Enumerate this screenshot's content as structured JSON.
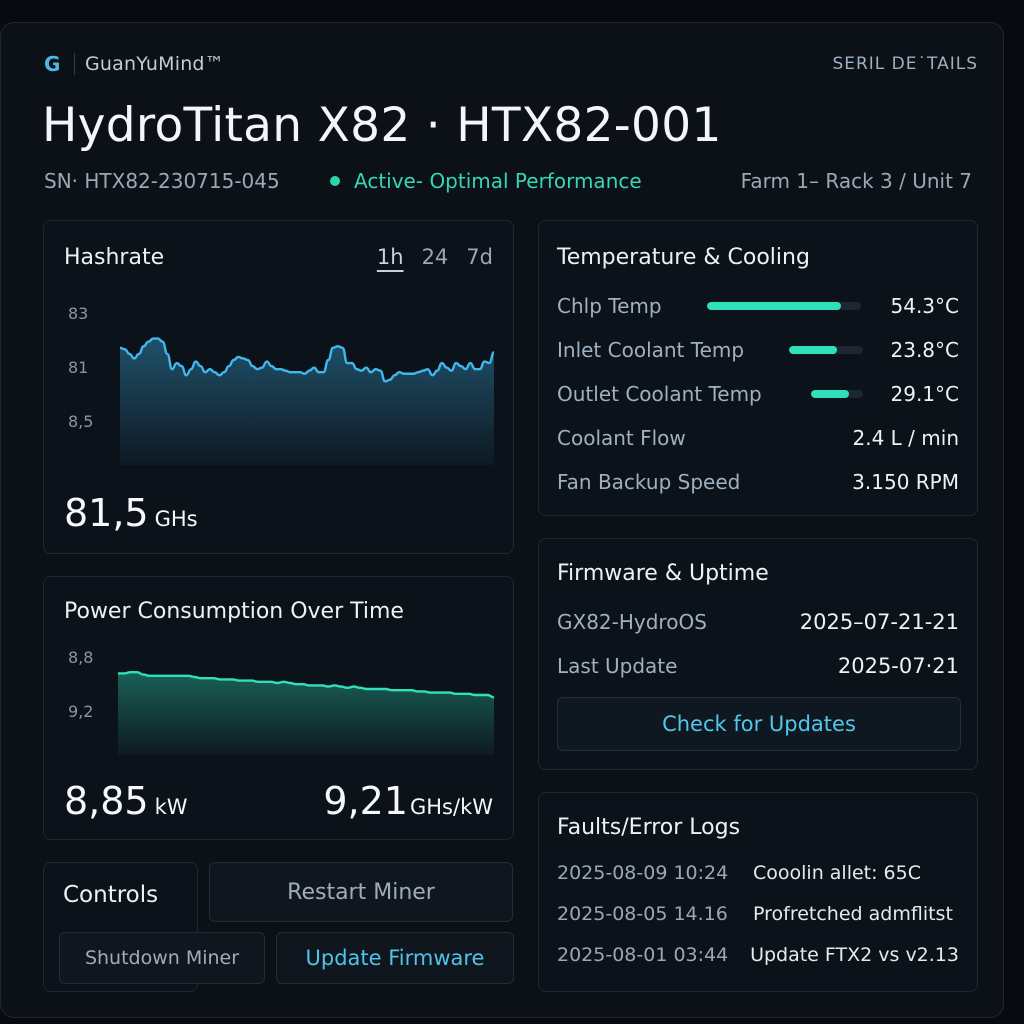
{
  "header": {
    "brand": "GuanYuMind™",
    "brand_icon": "G",
    "serial_link": "SERIL DE˙TAILS",
    "title": "HydroTitan X82 · HTX82-001",
    "serial": "SN· HTX82-230715-045",
    "status": "Active- Optimal Performance",
    "location": "Farm 1– Rack 3 / Unit 7"
  },
  "colors": {
    "accent": "#2ed3ad",
    "hash_line": "#3fb8f0",
    "power_line": "#2fe0bb",
    "link": "#4fc3e8"
  },
  "hashrate": {
    "title": "Hashrate",
    "ranges": [
      "1h",
      "24",
      "7d"
    ],
    "active_range": "1h",
    "value": "81,5",
    "unit": "GHs"
  },
  "power": {
    "title": "Power Consumption Over Time",
    "value": "8,85",
    "unit": "kW",
    "efficiency_value": "9,21",
    "efficiency_unit": "GHs/kW"
  },
  "chart_data": [
    {
      "type": "area",
      "name": "hashrate",
      "y_tick_labels": [
        "83",
        "81",
        "8,5"
      ],
      "ylim": [
        80,
        83.6
      ],
      "grid": false,
      "x": [
        0,
        1,
        2,
        3,
        4,
        5,
        6,
        7,
        8,
        9,
        10,
        11,
        12,
        13,
        14,
        15,
        16,
        17,
        18,
        19,
        20,
        21,
        22,
        23,
        24,
        25,
        26,
        27,
        28,
        29,
        30,
        31,
        32,
        33,
        34,
        35,
        36,
        37,
        38,
        39,
        40,
        41,
        42,
        43,
        44,
        45,
        46,
        47,
        48,
        49,
        50,
        51,
        52,
        53,
        54,
        55,
        56,
        57,
        58,
        59,
        60,
        61,
        62,
        63,
        64,
        65,
        66,
        67,
        68,
        69,
        70,
        71,
        72,
        73,
        74,
        75,
        76,
        77,
        78,
        79
      ],
      "y": [
        82.2,
        82.15,
        82.0,
        81.85,
        82.0,
        82.25,
        82.4,
        82.5,
        82.5,
        82.4,
        82.0,
        81.5,
        81.7,
        81.6,
        81.3,
        81.5,
        81.75,
        81.6,
        81.4,
        81.5,
        81.4,
        81.3,
        81.4,
        81.6,
        81.8,
        81.9,
        81.85,
        81.8,
        81.6,
        81.5,
        81.55,
        81.75,
        81.6,
        81.5,
        81.5,
        81.45,
        81.4,
        81.4,
        81.4,
        81.35,
        81.45,
        81.55,
        81.4,
        81.4,
        81.8,
        82.2,
        82.25,
        82.2,
        81.7,
        81.7,
        81.5,
        81.45,
        81.55,
        81.4,
        81.5,
        81.45,
        81.1,
        81.15,
        81.3,
        81.4,
        81.35,
        81.35,
        81.35,
        81.4,
        81.45,
        81.5,
        81.3,
        81.45,
        81.7,
        81.55,
        81.45,
        81.7,
        81.6,
        81.5,
        81.7,
        81.5,
        81.5,
        81.75,
        81.7,
        82.05
      ]
    },
    {
      "type": "area",
      "name": "power",
      "y_tick_labels": [
        "8,8",
        "9,2"
      ],
      "ylim": [
        8.6,
        9.3
      ],
      "grid": false,
      "x": [
        0,
        1,
        2,
        3,
        4,
        5,
        6,
        7,
        8,
        9,
        10,
        11,
        12,
        13,
        14,
        15,
        16,
        17,
        18,
        19,
        20,
        21,
        22,
        23,
        24,
        25,
        26,
        27,
        28,
        29,
        30,
        31,
        32,
        33,
        34,
        35,
        36,
        37,
        38,
        39,
        40,
        41,
        42,
        43,
        44,
        45,
        46,
        47,
        48,
        49,
        50,
        51,
        52,
        53,
        54,
        55,
        56,
        57,
        58,
        59
      ],
      "y": [
        9.13,
        9.13,
        9.14,
        9.14,
        9.12,
        9.11,
        9.11,
        9.11,
        9.11,
        9.11,
        9.11,
        9.11,
        9.1,
        9.09,
        9.09,
        9.09,
        9.08,
        9.08,
        9.08,
        9.07,
        9.07,
        9.07,
        9.06,
        9.06,
        9.06,
        9.05,
        9.06,
        9.05,
        9.04,
        9.04,
        9.03,
        9.03,
        9.03,
        9.02,
        9.03,
        9.02,
        9.01,
        9.02,
        9.01,
        9.0,
        9.0,
        9.0,
        9.0,
        8.99,
        8.99,
        8.99,
        8.99,
        8.98,
        8.98,
        8.97,
        8.97,
        8.97,
        8.97,
        8.96,
        8.96,
        8.96,
        8.95,
        8.95,
        8.95,
        8.93
      ]
    }
  ],
  "temperature": {
    "title": "Temperature & Cooling",
    "rows": [
      {
        "label": "Chlp Temp",
        "value": "54.3°C",
        "fill": 0.87
      },
      {
        "label": "Inlet Coolant Temp",
        "value": "23.8°C",
        "fill": 0.65
      },
      {
        "label": "Outlet Coolant Temp",
        "value": "29.1°C",
        "fill": 0.74
      },
      {
        "label": "Coolant Flow",
        "value": "2.4 L / min"
      },
      {
        "label": "Fan Backup Speed",
        "value": "3.150 RPM"
      }
    ]
  },
  "firmware": {
    "title": "Firmware & Uptime",
    "version_label": "GX82-HydroOS",
    "version_value": "2025–07-21-21",
    "update_label": "Last Update",
    "update_value": "2025-07·21",
    "check_button": "Check for Updates"
  },
  "faults": {
    "title": "Faults/Error  Logs",
    "rows": [
      {
        "ts": "2025-08-09 10:24",
        "msg": "Cooolin allet: 65C"
      },
      {
        "ts": "2025-08-05 14.16",
        "msg": "Profretched admflitst"
      },
      {
        "ts": "2025-08-01 03:44",
        "msg": "Update FTX2 vs v2.13"
      }
    ]
  },
  "controls": {
    "title": "Controls",
    "restart": "Restart Miner",
    "shutdown": "Shutdown Miner",
    "update": "Update Firmware"
  }
}
